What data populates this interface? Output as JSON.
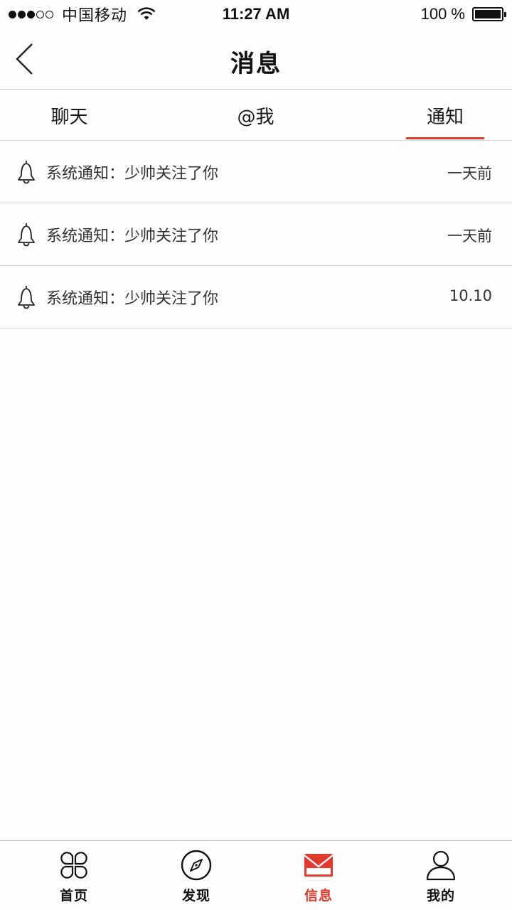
{
  "status_bar": {
    "carrier": "中国移动",
    "time": "11:27 AM",
    "battery": "100 %",
    "battery_level": 1.0
  },
  "nav": {
    "title": "消息"
  },
  "tabs": [
    {
      "label": "聊天"
    },
    {
      "label": "@我"
    },
    {
      "label": "通知"
    }
  ],
  "active_tab": "通知",
  "notifications": [
    {
      "text": "系统通知：少帅关注了你",
      "time": "一天前",
      "icon": "bell-icon"
    },
    {
      "text": "系统通知：少帅关注了你",
      "time": "一天前",
      "icon": "bell-icon"
    },
    {
      "text": "系统通知：少帅关注了你",
      "time": "10.10",
      "icon": "bell-icon"
    }
  ],
  "tab_bar": [
    {
      "label": "首页",
      "icon": "clover-icon"
    },
    {
      "label": "发现",
      "icon": "compass-icon"
    },
    {
      "label": "信息",
      "icon": "envelope-icon"
    },
    {
      "label": "我的",
      "icon": "person-icon"
    }
  ],
  "colors": {
    "accent": "#e03b2e",
    "text": "#111111",
    "divider": "#d4d4d4"
  }
}
